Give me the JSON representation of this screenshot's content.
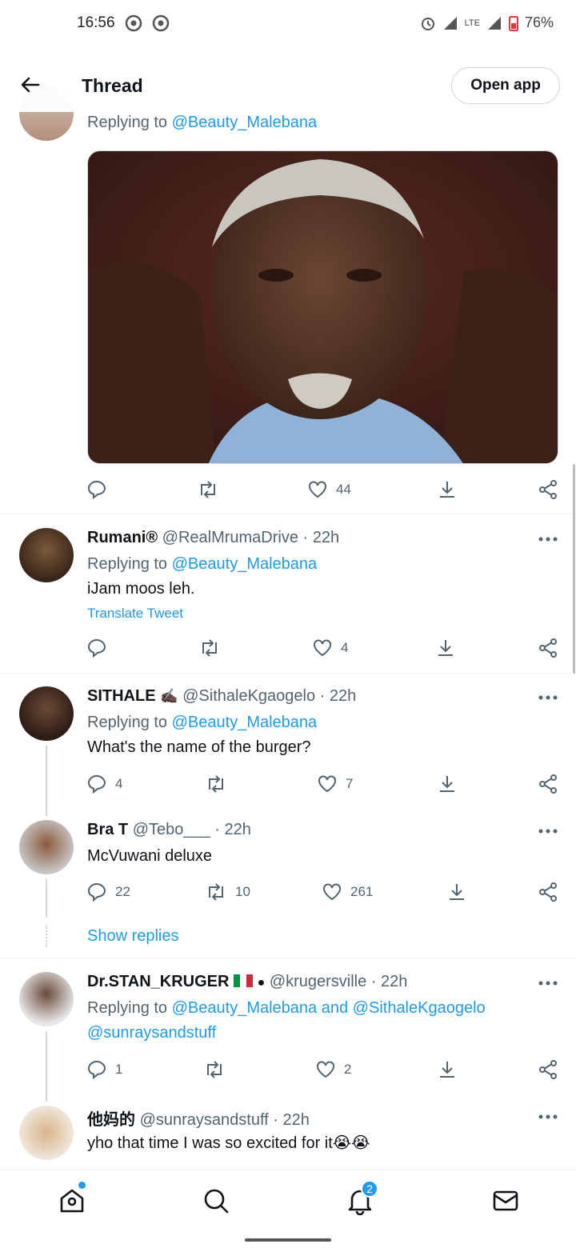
{
  "status": {
    "time": "16:56",
    "network": "LTE",
    "battery": "76%"
  },
  "header": {
    "title": "Thread",
    "open_app": "Open app"
  },
  "top_tweet": {
    "replying_prefix": "Replying to",
    "replying_to": "@Beauty_Malebana",
    "actions": {
      "replies": "",
      "retweets": "",
      "likes": "44"
    }
  },
  "tweets": [
    {
      "name": "Rumani®",
      "handle": "@RealMrumaDrive",
      "time": "· 22h",
      "replying_prefix": "Replying to",
      "replying_to": "@Beauty_Malebana",
      "text": "iJam moos leh.",
      "translate": "Translate Tweet",
      "replies": "",
      "retweets": "",
      "likes": "4"
    },
    {
      "name": "SITHALE",
      "handle": "@SithaleKgaogelo",
      "time": "· 22h",
      "replying_prefix": "Replying to",
      "replying_to": "@Beauty_Malebana",
      "text": "What's the name of the burger?",
      "replies": "4",
      "retweets": "",
      "likes": "7"
    },
    {
      "name": "Bra T",
      "handle": "@Tebo___",
      "time": "· 22h",
      "text": "McVuwani deluxe",
      "replies": "22",
      "retweets": "10",
      "likes": "261"
    },
    {
      "name": "Dr.STAN_KRUGER",
      "handle": "@krugersville",
      "time": "· 22h",
      "replying_prefix": "Replying to",
      "replying_to_1": "@Beauty_Malebana",
      "replying_and": "and",
      "replying_to_2": "@SithaleKgaogelo",
      "replying_to_3": "@sunraysandstuff",
      "replies": "1",
      "retweets": "",
      "likes": "2"
    },
    {
      "name": "他妈的",
      "handle": "@sunraysandstuff",
      "time": "· 22h",
      "text": "yho that time I was so excited for it😭😭"
    }
  ],
  "show_replies": "Show replies",
  "nav": {
    "notifications_badge": "2"
  },
  "colors": {
    "accent": "#1d9bf0",
    "text": "#0f1419",
    "secondary": "#536471"
  }
}
